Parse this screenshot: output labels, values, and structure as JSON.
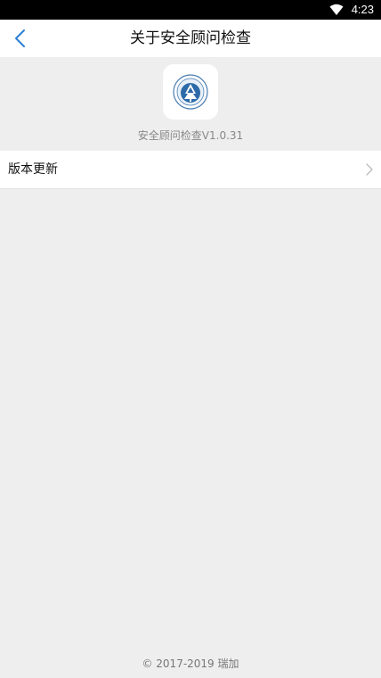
{
  "status_bar": {
    "time": "4:23",
    "icons": [
      "wifi-icon"
    ]
  },
  "app_bar": {
    "title": "关于安全顾问检查",
    "back_icon": "chevron-left-icon"
  },
  "about": {
    "logo_icon": "app-logo-icon",
    "version": "安全顾问检查V1.0.31"
  },
  "menu": {
    "update_label": "版本更新",
    "update_icon": "chevron-right-icon"
  },
  "footer": {
    "copyright": "© 2017-2019 瑞加"
  },
  "colors": {
    "accent": "#2b7fd3",
    "background": "#eeeeee",
    "surface": "#ffffff"
  }
}
